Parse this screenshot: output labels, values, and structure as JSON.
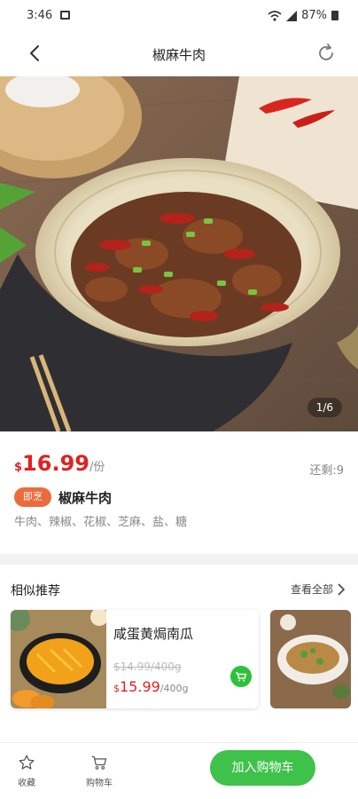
{
  "status_bar": {
    "time": "3:46",
    "battery": "87%"
  },
  "header": {
    "title": "椒麻牛肉"
  },
  "hero": {
    "counter": "1/6"
  },
  "product": {
    "currency": "$",
    "price": "16.99",
    "unit": "/份",
    "stock": "还剩:9",
    "tag": "即烹",
    "name": "椒麻牛肉",
    "ingredients": "牛肉、辣椒、花椒、芝麻、盐、糖"
  },
  "similar": {
    "title": "相似推荐",
    "more": "查看全部",
    "items": [
      {
        "name": "咸蛋黄焗南瓜",
        "old_price": "$14.99/400g",
        "currency": "$",
        "price": "15.99",
        "unit": "/400g"
      }
    ]
  },
  "bottom_bar": {
    "favorite_label": "收藏",
    "cart_label": "购物车",
    "add_to_cart_label": "加入购物车"
  },
  "colors": {
    "accent_green": "#3ec24a",
    "price_red": "#e02222",
    "tag_orange": "#ec6b3d"
  }
}
